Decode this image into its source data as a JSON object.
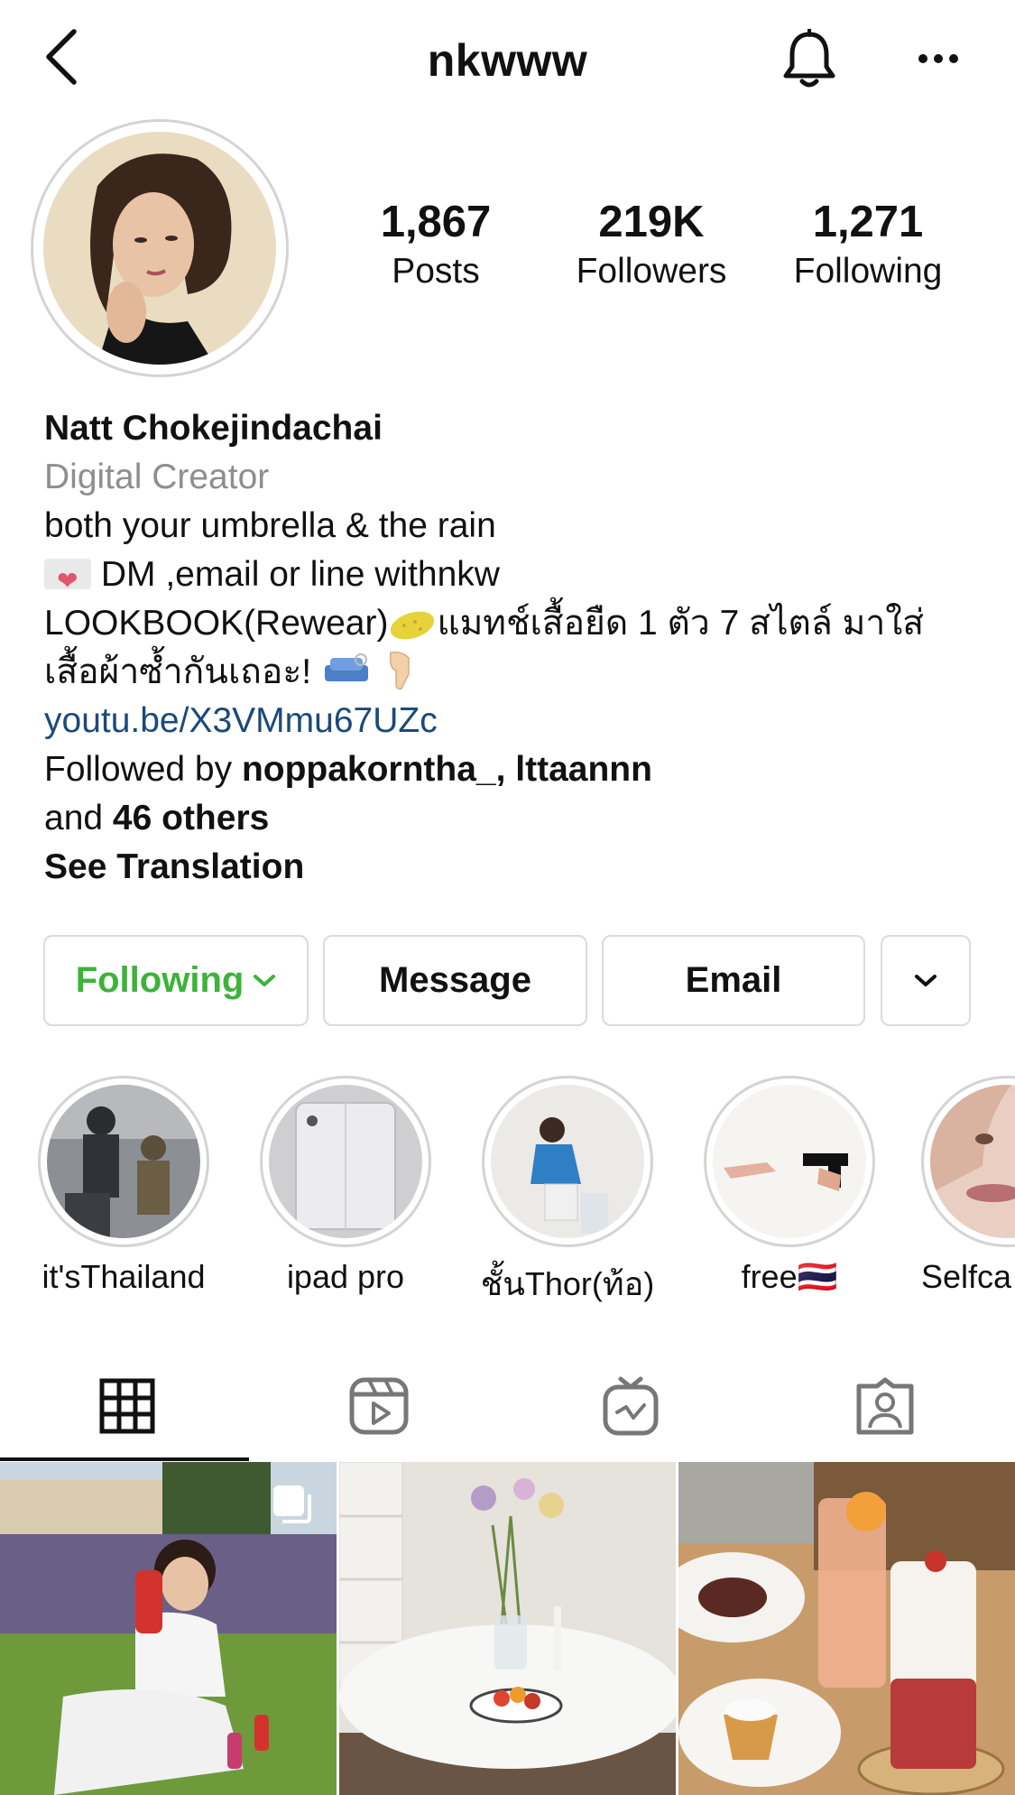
{
  "header": {
    "username": "nkwww"
  },
  "stats": {
    "posts": {
      "value": "1,867",
      "label": "Posts"
    },
    "followers": {
      "value": "219K",
      "label": "Followers"
    },
    "following": {
      "value": "1,271",
      "label": "Following"
    }
  },
  "bio": {
    "name": "Natt Chokejindachai",
    "category": "Digital Creator",
    "line1": "both your umbrella & the rain",
    "line2": "DM ,email or line withnkw",
    "line3a": "LOOKBOOK(Rewear)",
    "line3b": "แมทช์เสื้อยืด 1 ตัว 7 สไตล์ มาใส่",
    "line4": "เสื้อผ้าซ้ำกันเถอะ!",
    "link": "youtu.be/X3VMmu67UZc",
    "followed_prefix": "Followed by ",
    "followed_names": "noppakorntha_, lttaannn",
    "followed_and": "and ",
    "followed_others": "46 others",
    "see_translation": "See Translation"
  },
  "actions": {
    "following": "Following",
    "message": "Message",
    "email": "Email"
  },
  "highlights": [
    {
      "label": "it'sThailand"
    },
    {
      "label": "ipad pro"
    },
    {
      "label": "ชั้นThor(ท้อ)"
    },
    {
      "label": "free🇹🇭"
    },
    {
      "label": "Selfca"
    }
  ],
  "icons": {
    "back": "chevron-left-icon",
    "bell": "bell-icon",
    "more": "more-horizontal-icon",
    "grid": "grid-icon",
    "reels": "reels-icon",
    "igtv": "igtv-icon",
    "tagged": "tagged-icon"
  },
  "colors": {
    "following_green": "#3db339",
    "link_blue": "#1a4a7a",
    "muted": "#8e8e8e"
  }
}
